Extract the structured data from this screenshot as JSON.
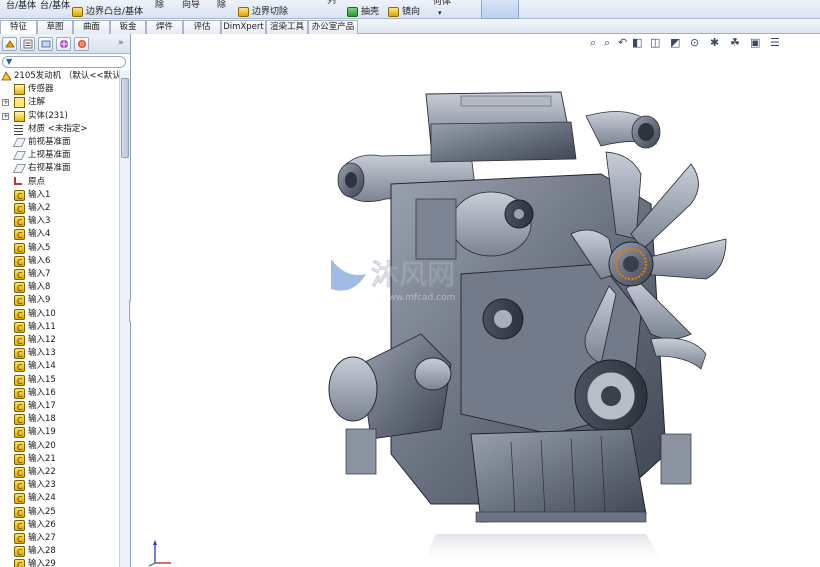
{
  "ribbon": {
    "items": [
      {
        "label": "台/基体"
      },
      {
        "label": "台/基体"
      },
      {
        "label": "边界凸台/基体"
      },
      {
        "label": "除"
      },
      {
        "label": "向导"
      },
      {
        "label": "除"
      },
      {
        "label": "边界切除"
      },
      {
        "label": "列"
      },
      {
        "label": "抽壳"
      },
      {
        "label": "镜向"
      },
      {
        "label": "何体"
      }
    ]
  },
  "tabs": [
    "特征",
    "草图",
    "曲面",
    "钣金",
    "焊件",
    "评估",
    "DimXpert",
    "渲染工具",
    "办公室产品"
  ],
  "tree": {
    "root": "2105发动机 （默认<<默认>_",
    "items": [
      {
        "label": "传感器",
        "icon": "sensor-icon",
        "expandable": false
      },
      {
        "label": "注解",
        "icon": "annotation-icon",
        "expandable": true
      },
      {
        "label": "实体(231)",
        "icon": "solid-bodies-icon",
        "expandable": true
      },
      {
        "label": "材质 <未指定>",
        "icon": "material-icon",
        "expandable": false
      },
      {
        "label": "前视基准面",
        "icon": "plane-icon",
        "expandable": false
      },
      {
        "label": "上视基准面",
        "icon": "plane-icon",
        "expandable": false
      },
      {
        "label": "右视基准面",
        "icon": "plane-icon",
        "expandable": false
      },
      {
        "label": "原点",
        "icon": "origin-icon",
        "expandable": false
      },
      {
        "label": "输入1",
        "icon": "imported-body-icon",
        "expandable": false
      },
      {
        "label": "输入2",
        "icon": "imported-body-icon",
        "expandable": false
      },
      {
        "label": "输入3",
        "icon": "imported-body-icon",
        "expandable": false
      },
      {
        "label": "输入4",
        "icon": "imported-body-icon",
        "expandable": false
      },
      {
        "label": "输入5",
        "icon": "imported-body-icon",
        "expandable": false
      },
      {
        "label": "输入6",
        "icon": "imported-body-icon",
        "expandable": false
      },
      {
        "label": "输入7",
        "icon": "imported-body-icon",
        "expandable": false
      },
      {
        "label": "输入8",
        "icon": "imported-body-icon",
        "expandable": false
      },
      {
        "label": "输入9",
        "icon": "imported-body-icon",
        "expandable": false
      },
      {
        "label": "输入10",
        "icon": "imported-body-icon",
        "expandable": false
      },
      {
        "label": "输入11",
        "icon": "imported-body-icon",
        "expandable": false
      },
      {
        "label": "输入12",
        "icon": "imported-body-icon",
        "expandable": false
      },
      {
        "label": "输入13",
        "icon": "imported-body-icon",
        "expandable": false
      },
      {
        "label": "输入14",
        "icon": "imported-body-icon",
        "expandable": false
      },
      {
        "label": "输入15",
        "icon": "imported-body-icon",
        "expandable": false
      },
      {
        "label": "输入16",
        "icon": "imported-body-icon",
        "expandable": false
      },
      {
        "label": "输入17",
        "icon": "imported-body-icon",
        "expandable": false
      },
      {
        "label": "输入18",
        "icon": "imported-body-icon",
        "expandable": false
      },
      {
        "label": "输入19",
        "icon": "imported-body-icon",
        "expandable": false
      },
      {
        "label": "输入20",
        "icon": "imported-body-icon",
        "expandable": false
      },
      {
        "label": "输入21",
        "icon": "imported-body-icon",
        "expandable": false
      },
      {
        "label": "输入22",
        "icon": "imported-body-icon",
        "expandable": false
      },
      {
        "label": "输入23",
        "icon": "imported-body-icon",
        "expandable": false
      },
      {
        "label": "输入24",
        "icon": "imported-body-icon",
        "expandable": false
      },
      {
        "label": "输入25",
        "icon": "imported-body-icon",
        "expandable": false
      },
      {
        "label": "输入26",
        "icon": "imported-body-icon",
        "expandable": false
      },
      {
        "label": "输入27",
        "icon": "imported-body-icon",
        "expandable": false
      },
      {
        "label": "输入28",
        "icon": "imported-body-icon",
        "expandable": false
      },
      {
        "label": "输入29",
        "icon": "imported-body-icon",
        "expandable": false
      }
    ]
  },
  "watermark": {
    "text": "沐风网",
    "url": "www.mfcad.com"
  },
  "colors": {
    "model_body": "#6b7282",
    "model_dark": "#3f4552",
    "model_light": "#aab1bd",
    "accent_orange": "#e8780c",
    "ribbon_bg": "#dde6f3"
  }
}
